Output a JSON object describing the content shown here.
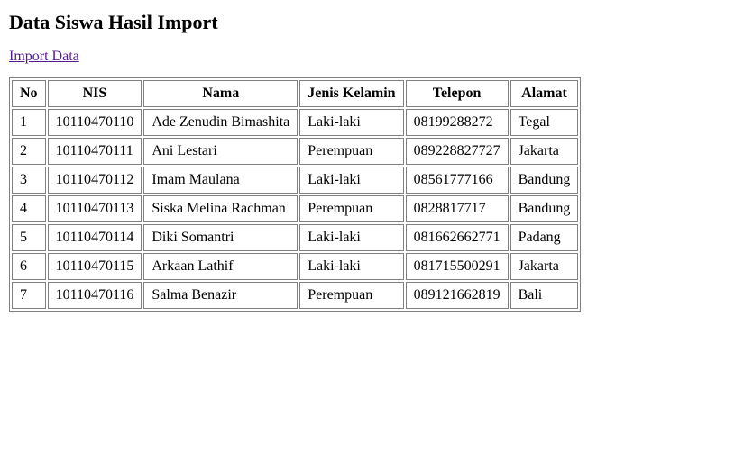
{
  "title": "Data Siswa Hasil Import",
  "import_link_label": "Import Data",
  "table": {
    "headers": {
      "no": "No",
      "nis": "NIS",
      "nama": "Nama",
      "jenis_kelamin": "Jenis Kelamin",
      "telepon": "Telepon",
      "alamat": "Alamat"
    },
    "rows": [
      {
        "no": "1",
        "nis": "10110470110",
        "nama": "Ade Zenudin Bimashita",
        "jenis_kelamin": "Laki-laki",
        "telepon": "08199288272",
        "alamat": "Tegal"
      },
      {
        "no": "2",
        "nis": "10110470111",
        "nama": "Ani Lestari",
        "jenis_kelamin": "Perempuan",
        "telepon": "089228827727",
        "alamat": "Jakarta"
      },
      {
        "no": "3",
        "nis": "10110470112",
        "nama": "Imam Maulana",
        "jenis_kelamin": "Laki-laki",
        "telepon": "08561777166",
        "alamat": "Bandung"
      },
      {
        "no": "4",
        "nis": "10110470113",
        "nama": "Siska Melina Rachman",
        "jenis_kelamin": "Perempuan",
        "telepon": "0828817717",
        "alamat": "Bandung"
      },
      {
        "no": "5",
        "nis": "10110470114",
        "nama": "Diki Somantri",
        "jenis_kelamin": "Laki-laki",
        "telepon": "081662662771",
        "alamat": "Padang"
      },
      {
        "no": "6",
        "nis": "10110470115",
        "nama": "Arkaan Lathif",
        "jenis_kelamin": "Laki-laki",
        "telepon": "081715500291",
        "alamat": "Jakarta"
      },
      {
        "no": "7",
        "nis": "10110470116",
        "nama": "Salma Benazir",
        "jenis_kelamin": "Perempuan",
        "telepon": "089121662819",
        "alamat": "Bali"
      }
    ]
  }
}
